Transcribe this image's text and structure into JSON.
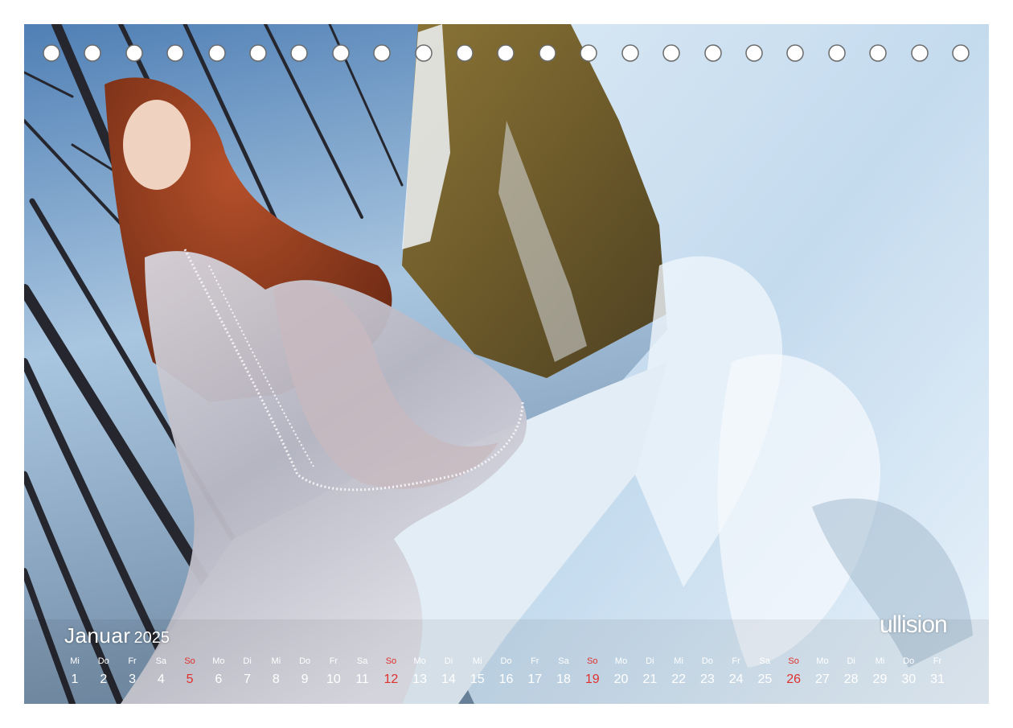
{
  "calendar": {
    "month": "Januar",
    "year": "2025",
    "brand": "ullision",
    "sunday_color": "#e0302c",
    "text_color": "#ffffff",
    "days": [
      {
        "name": "Mi",
        "num": "1"
      },
      {
        "name": "Do",
        "num": "2"
      },
      {
        "name": "Fr",
        "num": "3"
      },
      {
        "name": "Sa",
        "num": "4"
      },
      {
        "name": "So",
        "num": "5"
      },
      {
        "name": "Mo",
        "num": "6"
      },
      {
        "name": "Di",
        "num": "7"
      },
      {
        "name": "Mi",
        "num": "8"
      },
      {
        "name": "Do",
        "num": "9"
      },
      {
        "name": "Fr",
        "num": "10"
      },
      {
        "name": "Sa",
        "num": "11"
      },
      {
        "name": "So",
        "num": "12"
      },
      {
        "name": "Mo",
        "num": "13"
      },
      {
        "name": "Di",
        "num": "14"
      },
      {
        "name": "Mi",
        "num": "15"
      },
      {
        "name": "Do",
        "num": "16"
      },
      {
        "name": "Fr",
        "num": "17"
      },
      {
        "name": "Sa",
        "num": "18"
      },
      {
        "name": "So",
        "num": "19"
      },
      {
        "name": "Mo",
        "num": "20"
      },
      {
        "name": "Di",
        "num": "21"
      },
      {
        "name": "Mi",
        "num": "22"
      },
      {
        "name": "Do",
        "num": "23"
      },
      {
        "name": "Fr",
        "num": "24"
      },
      {
        "name": "Sa",
        "num": "25"
      },
      {
        "name": "So",
        "num": "26"
      },
      {
        "name": "Mo",
        "num": "27"
      },
      {
        "name": "Di",
        "num": "28"
      },
      {
        "name": "Mi",
        "num": "29"
      },
      {
        "name": "Do",
        "num": "30"
      },
      {
        "name": "Fr",
        "num": "31"
      }
    ]
  }
}
